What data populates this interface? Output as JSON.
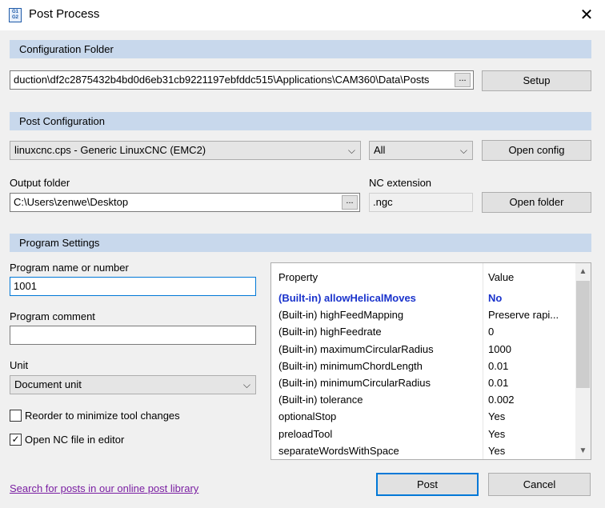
{
  "window": {
    "title": "Post Process",
    "icon_text": "G1 G2",
    "close_glyph": "✕"
  },
  "config_folder": {
    "header": "Configuration Folder",
    "path": "duction\\df2c2875432b4bd0d6eb31cb9221197ebfddc515\\Applications\\CAM360\\Data\\Posts",
    "browse_label": "...",
    "setup_label": "Setup"
  },
  "post_config": {
    "header": "Post Configuration",
    "selected_post": "linuxcnc.cps - Generic LinuxCNC (EMC2)",
    "filter_value": "All",
    "open_config_label": "Open config",
    "output_folder_label": "Output folder",
    "output_folder_path": "C:\\Users\\zenwe\\Desktop",
    "browse_label": "...",
    "nc_extension_label": "NC extension",
    "nc_extension_value": ".ngc",
    "open_folder_label": "Open folder"
  },
  "program_settings": {
    "header": "Program Settings",
    "program_name_label": "Program name or number",
    "program_name_value": "1001",
    "program_comment_label": "Program comment",
    "program_comment_value": "",
    "unit_label": "Unit",
    "unit_value": "Document unit",
    "reorder_label": "Reorder to minimize tool changes",
    "reorder_checked": false,
    "open_nc_label": "Open NC file in editor",
    "open_nc_checked": true,
    "check_glyph": "✓"
  },
  "properties": {
    "col_property": "Property",
    "col_value": "Value",
    "rows": [
      {
        "name": "(Built-in) allowHelicalMoves",
        "value": "No"
      },
      {
        "name": "(Built-in) highFeedMapping",
        "value": "Preserve rapi..."
      },
      {
        "name": "(Built-in) highFeedrate",
        "value": "0"
      },
      {
        "name": "(Built-in) maximumCircularRadius",
        "value": "1000"
      },
      {
        "name": "(Built-in) minimumChordLength",
        "value": "0.01"
      },
      {
        "name": "(Built-in) minimumCircularRadius",
        "value": "0.01"
      },
      {
        "name": "(Built-in) tolerance",
        "value": "0.002"
      },
      {
        "name": "optionalStop",
        "value": "Yes"
      },
      {
        "name": "preloadTool",
        "value": "Yes"
      },
      {
        "name": "separateWordsWithSpace",
        "value": "Yes"
      }
    ]
  },
  "footer": {
    "link_text": "Search for posts in our online post library",
    "post_label": "Post",
    "cancel_label": "Cancel"
  },
  "icons": {
    "chevron": "⌵",
    "scroll_up": "▲",
    "scroll_down": "▼"
  }
}
